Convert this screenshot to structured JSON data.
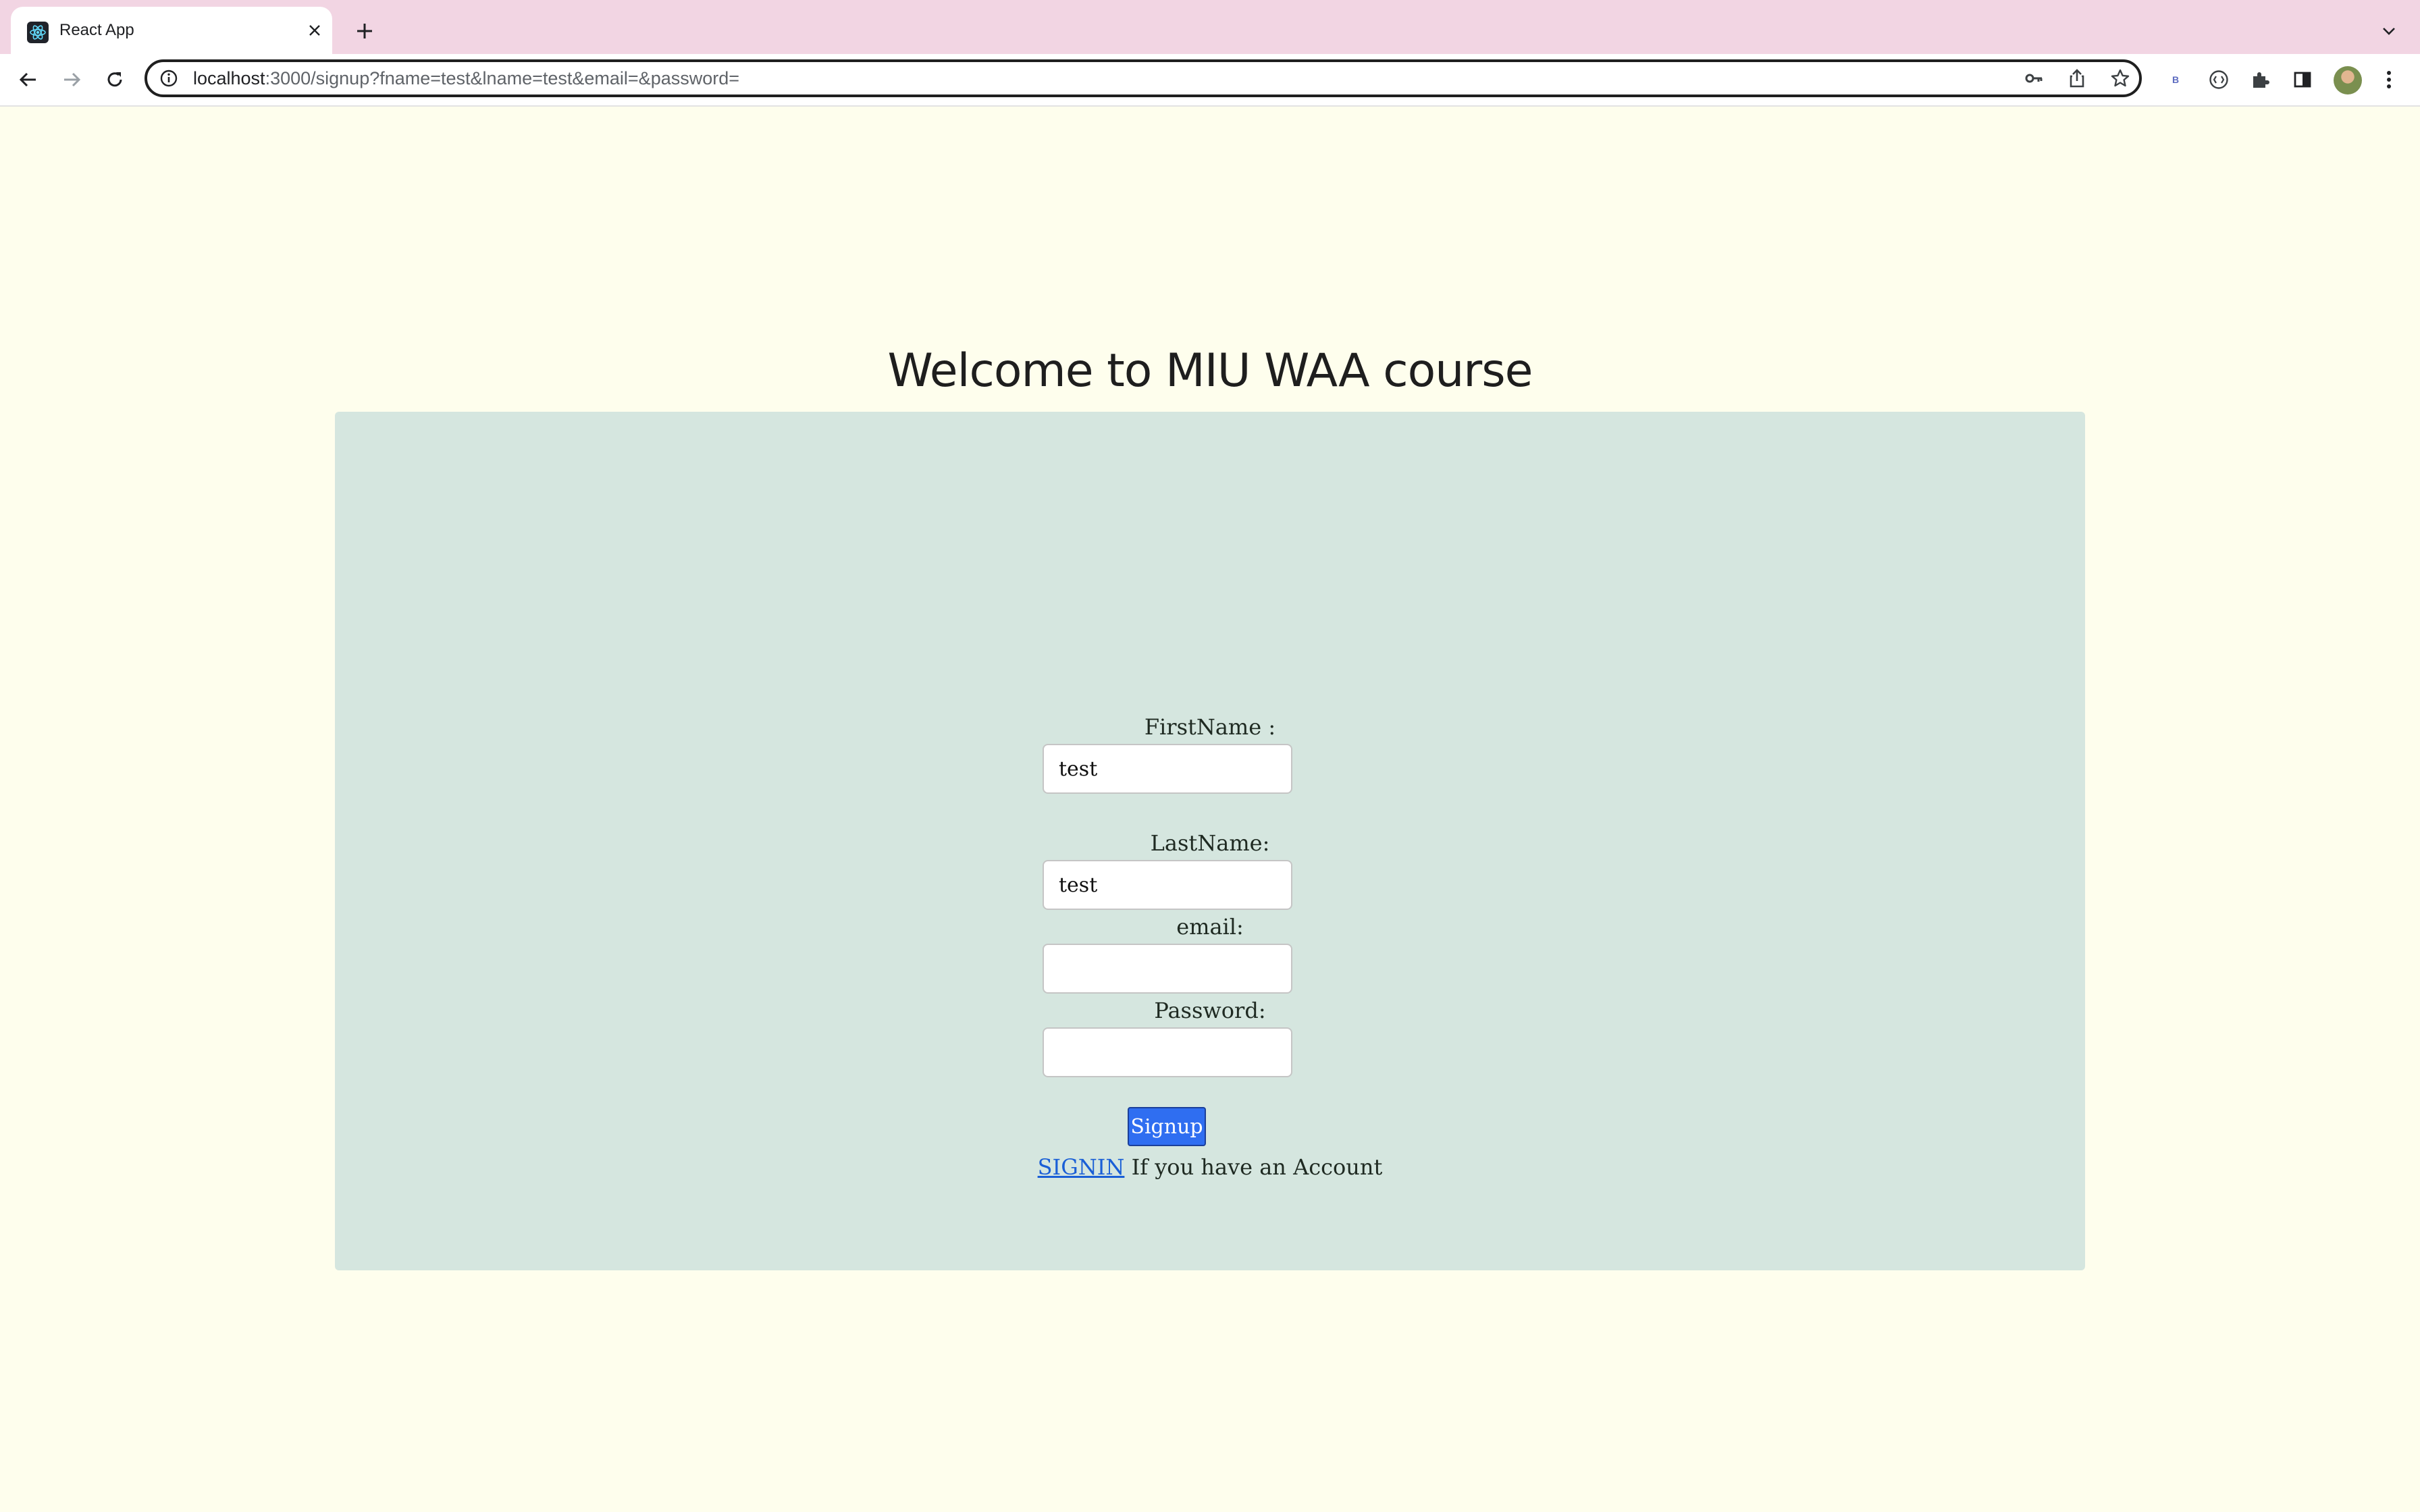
{
  "browser": {
    "tab": {
      "title": "React App",
      "favicon": "react-logo-icon"
    },
    "address": {
      "host": "localhost",
      "path": ":3000/signup?fname=test&lname=test&email=&password="
    },
    "icons": {
      "back": "arrow-left-icon",
      "forward": "arrow-right-icon",
      "reload": "reload-icon",
      "site_info": "info-icon",
      "password_key": "key-icon",
      "share": "share-icon",
      "bookmark": "star-icon",
      "extension_b": "B",
      "extensions": "puzzle-icon",
      "sidepanel": "side-panel-icon",
      "menu": "kebab-menu-icon"
    }
  },
  "page": {
    "title": "Welcome to MIU WAA course",
    "form": {
      "firstname_label": "FirstName :",
      "firstname_value": "test",
      "lastname_label": "LastName:",
      "lastname_value": "test",
      "email_label": "email:",
      "email_value": "",
      "password_label": "Password:",
      "password_value": "",
      "submit_label": "Signup",
      "signin_link": "SIGNIN",
      "signin_text": "If you have an Account"
    },
    "colors": {
      "page_bg": "#fefeed",
      "panel_bg": "#d5e6df",
      "button_bg": "#2f6ef1",
      "link": "#1a5fd6",
      "tabstrip_bg": "#f2d5e3"
    }
  }
}
